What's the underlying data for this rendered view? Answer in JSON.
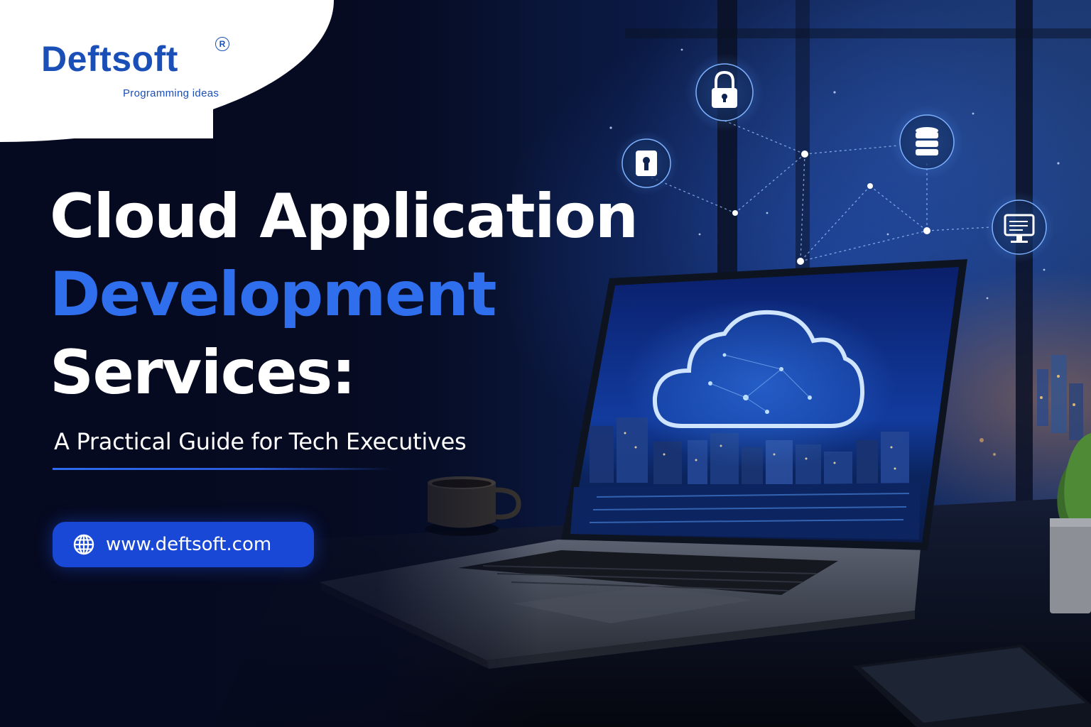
{
  "brand": {
    "name": "Deftsoft",
    "registered_mark": "R",
    "tagline": "Programming ideas"
  },
  "headline": {
    "line1": "Cloud Application",
    "line2": "Development",
    "line3": "Services:"
  },
  "subtitle": "A Practical Guide for Tech Executives",
  "website": {
    "url": "www.deftsoft.com",
    "icon": "globe-icon"
  },
  "illustration": {
    "icons": [
      "padlock-icon",
      "keyhole-lock-icon",
      "database-icon",
      "monitor-icon",
      "cloud-icon"
    ]
  },
  "colors": {
    "brand_blue": "#1a4fb8",
    "accent_blue": "#2f6fee",
    "pill_blue": "#1a48d6",
    "background": "#070d24",
    "text_white": "#ffffff"
  }
}
